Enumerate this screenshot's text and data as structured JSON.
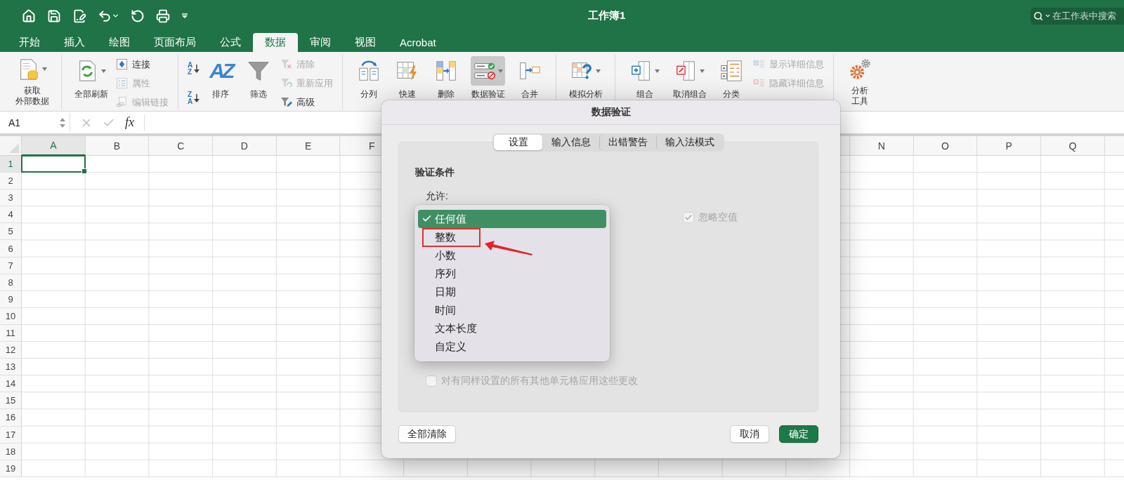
{
  "title_bar": {
    "title": "工作簿1",
    "search": {
      "placeholder": "在工作表中搜索"
    }
  },
  "tabs": [
    {
      "label": "开始",
      "selected": false
    },
    {
      "label": "插入",
      "selected": false
    },
    {
      "label": "绘图",
      "selected": false
    },
    {
      "label": "页面布局",
      "selected": false
    },
    {
      "label": "公式",
      "selected": false
    },
    {
      "label": "数据",
      "selected": true
    },
    {
      "label": "审阅",
      "selected": false
    },
    {
      "label": "视图",
      "selected": false
    },
    {
      "label": "Acrobat",
      "selected": false
    }
  ],
  "ribbon": {
    "groups": [
      {
        "items": [
          {
            "kind": "large",
            "lines": [
              "获取",
              "外部数据"
            ],
            "has_menu": true,
            "pressed": false
          }
        ]
      },
      {
        "items": [
          {
            "kind": "large",
            "lines": [
              "全部刷新"
            ],
            "has_menu": true,
            "pressed": false
          },
          {
            "kind": "stack",
            "buttons": [
              {
                "label": "连接",
                "disabled": false
              },
              {
                "label": "属性",
                "disabled": true
              },
              {
                "label": "编辑链接",
                "disabled": true
              }
            ]
          }
        ]
      },
      {
        "items": [
          {
            "kind": "sort",
            "buttons": [
              {
                "letters": [
                  "A",
                  "Z"
                ]
              },
              {
                "letters": [
                  "Z",
                  "A"
                ]
              }
            ]
          },
          {
            "kind": "large",
            "lines": [
              "排序"
            ],
            "glyph": "AZ",
            "has_menu": false,
            "pressed": false
          },
          {
            "kind": "large",
            "lines": [
              "筛选"
            ],
            "has_menu": false,
            "pressed": false
          },
          {
            "kind": "stack",
            "buttons": [
              {
                "label": "清除",
                "disabled": true
              },
              {
                "label": "重新应用",
                "disabled": true
              },
              {
                "label": "高级",
                "disabled": false
              }
            ]
          }
        ]
      },
      {
        "items": [
          {
            "kind": "large",
            "lines": [
              "分列"
            ],
            "has_menu": false,
            "pressed": false
          },
          {
            "kind": "large",
            "lines": [
              "快速"
            ],
            "has_menu": false,
            "pressed": false
          },
          {
            "kind": "large",
            "lines": [
              "删除"
            ],
            "has_menu": false,
            "pressed": false
          },
          {
            "kind": "large",
            "lines": [
              "数据验证"
            ],
            "has_menu": true,
            "pressed": true
          },
          {
            "kind": "large",
            "lines": [
              "合并"
            ],
            "has_menu": false,
            "pressed": false
          }
        ]
      },
      {
        "items": [
          {
            "kind": "large",
            "lines": [
              "模拟分析"
            ],
            "has_menu": true,
            "pressed": false
          }
        ]
      },
      {
        "items": [
          {
            "kind": "large",
            "lines": [
              "组合"
            ],
            "has_menu": true,
            "pressed": false
          },
          {
            "kind": "large",
            "lines": [
              "取消组合"
            ],
            "has_menu": true,
            "pressed": false
          },
          {
            "kind": "large",
            "lines": [
              "分类"
            ],
            "has_menu": false,
            "pressed": false
          },
          {
            "kind": "stack",
            "buttons": [
              {
                "label": "显示详细信息",
                "disabled": true
              },
              {
                "label": "隐藏详细信息",
                "disabled": true
              }
            ]
          }
        ]
      },
      {
        "items": [
          {
            "kind": "large",
            "lines": [
              "分析",
              "工具"
            ],
            "has_menu": false,
            "pressed": false
          }
        ]
      }
    ]
  },
  "formula_bar": {
    "name_box": "A1",
    "function_label": "fx"
  },
  "grid": {
    "columns_left": [
      {
        "label": "A",
        "selected": true
      },
      {
        "label": "B",
        "selected": false
      },
      {
        "label": "C",
        "selected": false
      },
      {
        "label": "D",
        "selected": false
      },
      {
        "label": "E",
        "selected": false
      },
      {
        "label": "F",
        "selected": false
      }
    ],
    "columns_right": [
      {
        "label": "N",
        "selected": false
      },
      {
        "label": "O",
        "selected": false
      },
      {
        "label": "P",
        "selected": false
      },
      {
        "label": "Q",
        "selected": false
      }
    ],
    "rows": [
      {
        "label": "1",
        "selected": true
      },
      {
        "label": "2",
        "selected": false
      },
      {
        "label": "3",
        "selected": false
      },
      {
        "label": "4",
        "selected": false
      },
      {
        "label": "5",
        "selected": false
      },
      {
        "label": "6",
        "selected": false
      },
      {
        "label": "7",
        "selected": false
      },
      {
        "label": "8",
        "selected": false
      },
      {
        "label": "9",
        "selected": false
      },
      {
        "label": "10",
        "selected": false
      },
      {
        "label": "11",
        "selected": false
      },
      {
        "label": "12",
        "selected": false
      },
      {
        "label": "13",
        "selected": false
      },
      {
        "label": "14",
        "selected": false
      },
      {
        "label": "15",
        "selected": false
      },
      {
        "label": "16",
        "selected": false
      },
      {
        "label": "17",
        "selected": false
      },
      {
        "label": "18",
        "selected": false
      },
      {
        "label": "19",
        "selected": false
      }
    ]
  },
  "dialog": {
    "title": "数据验证",
    "tabs": [
      {
        "label": "设置",
        "selected": true
      },
      {
        "label": "输入信息",
        "selected": false
      },
      {
        "label": "出错警告",
        "selected": false
      },
      {
        "label": "输入法模式",
        "selected": false
      }
    ],
    "section_title": "验证条件",
    "allow_label": "允许:",
    "allow_menu": [
      {
        "label": "任何值",
        "selected": true,
        "highlighted": false
      },
      {
        "label": "整数",
        "selected": false,
        "highlighted": true
      },
      {
        "label": "小数",
        "selected": false,
        "highlighted": false
      },
      {
        "label": "序列",
        "selected": false,
        "highlighted": false
      },
      {
        "label": "日期",
        "selected": false,
        "highlighted": false
      },
      {
        "label": "时间",
        "selected": false,
        "highlighted": false
      },
      {
        "label": "文本长度",
        "selected": false,
        "highlighted": false
      },
      {
        "label": "自定义",
        "selected": false,
        "highlighted": false
      }
    ],
    "ignore_blank": {
      "label": "忽略空值",
      "checked": true,
      "disabled": true
    },
    "apply_to_all": {
      "label": "对有同样设置的所有其他单元格应用这些更改",
      "checked": false,
      "disabled": true
    },
    "buttons": [
      {
        "label": "全部清除",
        "kind": "secondary"
      },
      {
        "label": "取消",
        "kind": "secondary"
      },
      {
        "label": "确定",
        "kind": "primary"
      }
    ]
  }
}
